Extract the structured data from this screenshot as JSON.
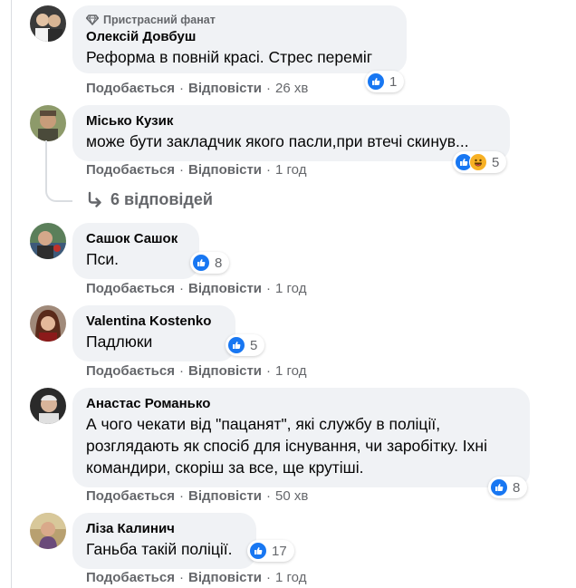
{
  "comments": [
    {
      "badge": "Пристрасний фанат",
      "author": "Олексій Довбуш",
      "text": "Реформа в повній красі. Стрес переміг",
      "reaction_count": "1",
      "like_label": "Подобається",
      "reply_label": "Відповісти",
      "time": "26 хв"
    },
    {
      "author": "Місько Кузик",
      "text": "може бути закладчик якого пасли,при втечі скинув...",
      "reaction_count": "5",
      "like_label": "Подобається",
      "reply_label": "Відповісти",
      "time": "1 год",
      "replies_label": "6 відповідей"
    },
    {
      "author": "Сашок Сашок",
      "text": "Пси.",
      "reaction_count": "8",
      "like_label": "Подобається",
      "reply_label": "Відповісти",
      "time": "1 год"
    },
    {
      "author": "Valentina Kostenko",
      "text": "Падлюки",
      "reaction_count": "5",
      "like_label": "Подобається",
      "reply_label": "Відповісти",
      "time": "1 год"
    },
    {
      "author": "Анастас Романько",
      "text_lines": [
        "А чого чекати від \"пацанят\", які службу в поліції,",
        "розглядають як спосіб для існування, чи заробітку. Іхні",
        "командири, скоріш за все, ще крутіші."
      ],
      "reaction_count": "8",
      "like_label": "Подобається",
      "reply_label": "Відповісти",
      "time": "50 хв"
    },
    {
      "author": "Ліза Калинич",
      "text": "Ганьба такій поліції.",
      "reaction_count": "17",
      "like_label": "Подобається",
      "reply_label": "Відповісти",
      "time": "1 год"
    }
  ],
  "icons": {
    "badge": "diamond-badge-icon",
    "like": "like-reaction-icon",
    "haha": "haha-reaction-icon",
    "reply_arrow": "reply-arrow-icon"
  },
  "colors": {
    "bubble": "#f0f2f5",
    "secondary_text": "#65676b",
    "like_blue": "#1877f2",
    "haha_yellow": "#f7b125"
  }
}
